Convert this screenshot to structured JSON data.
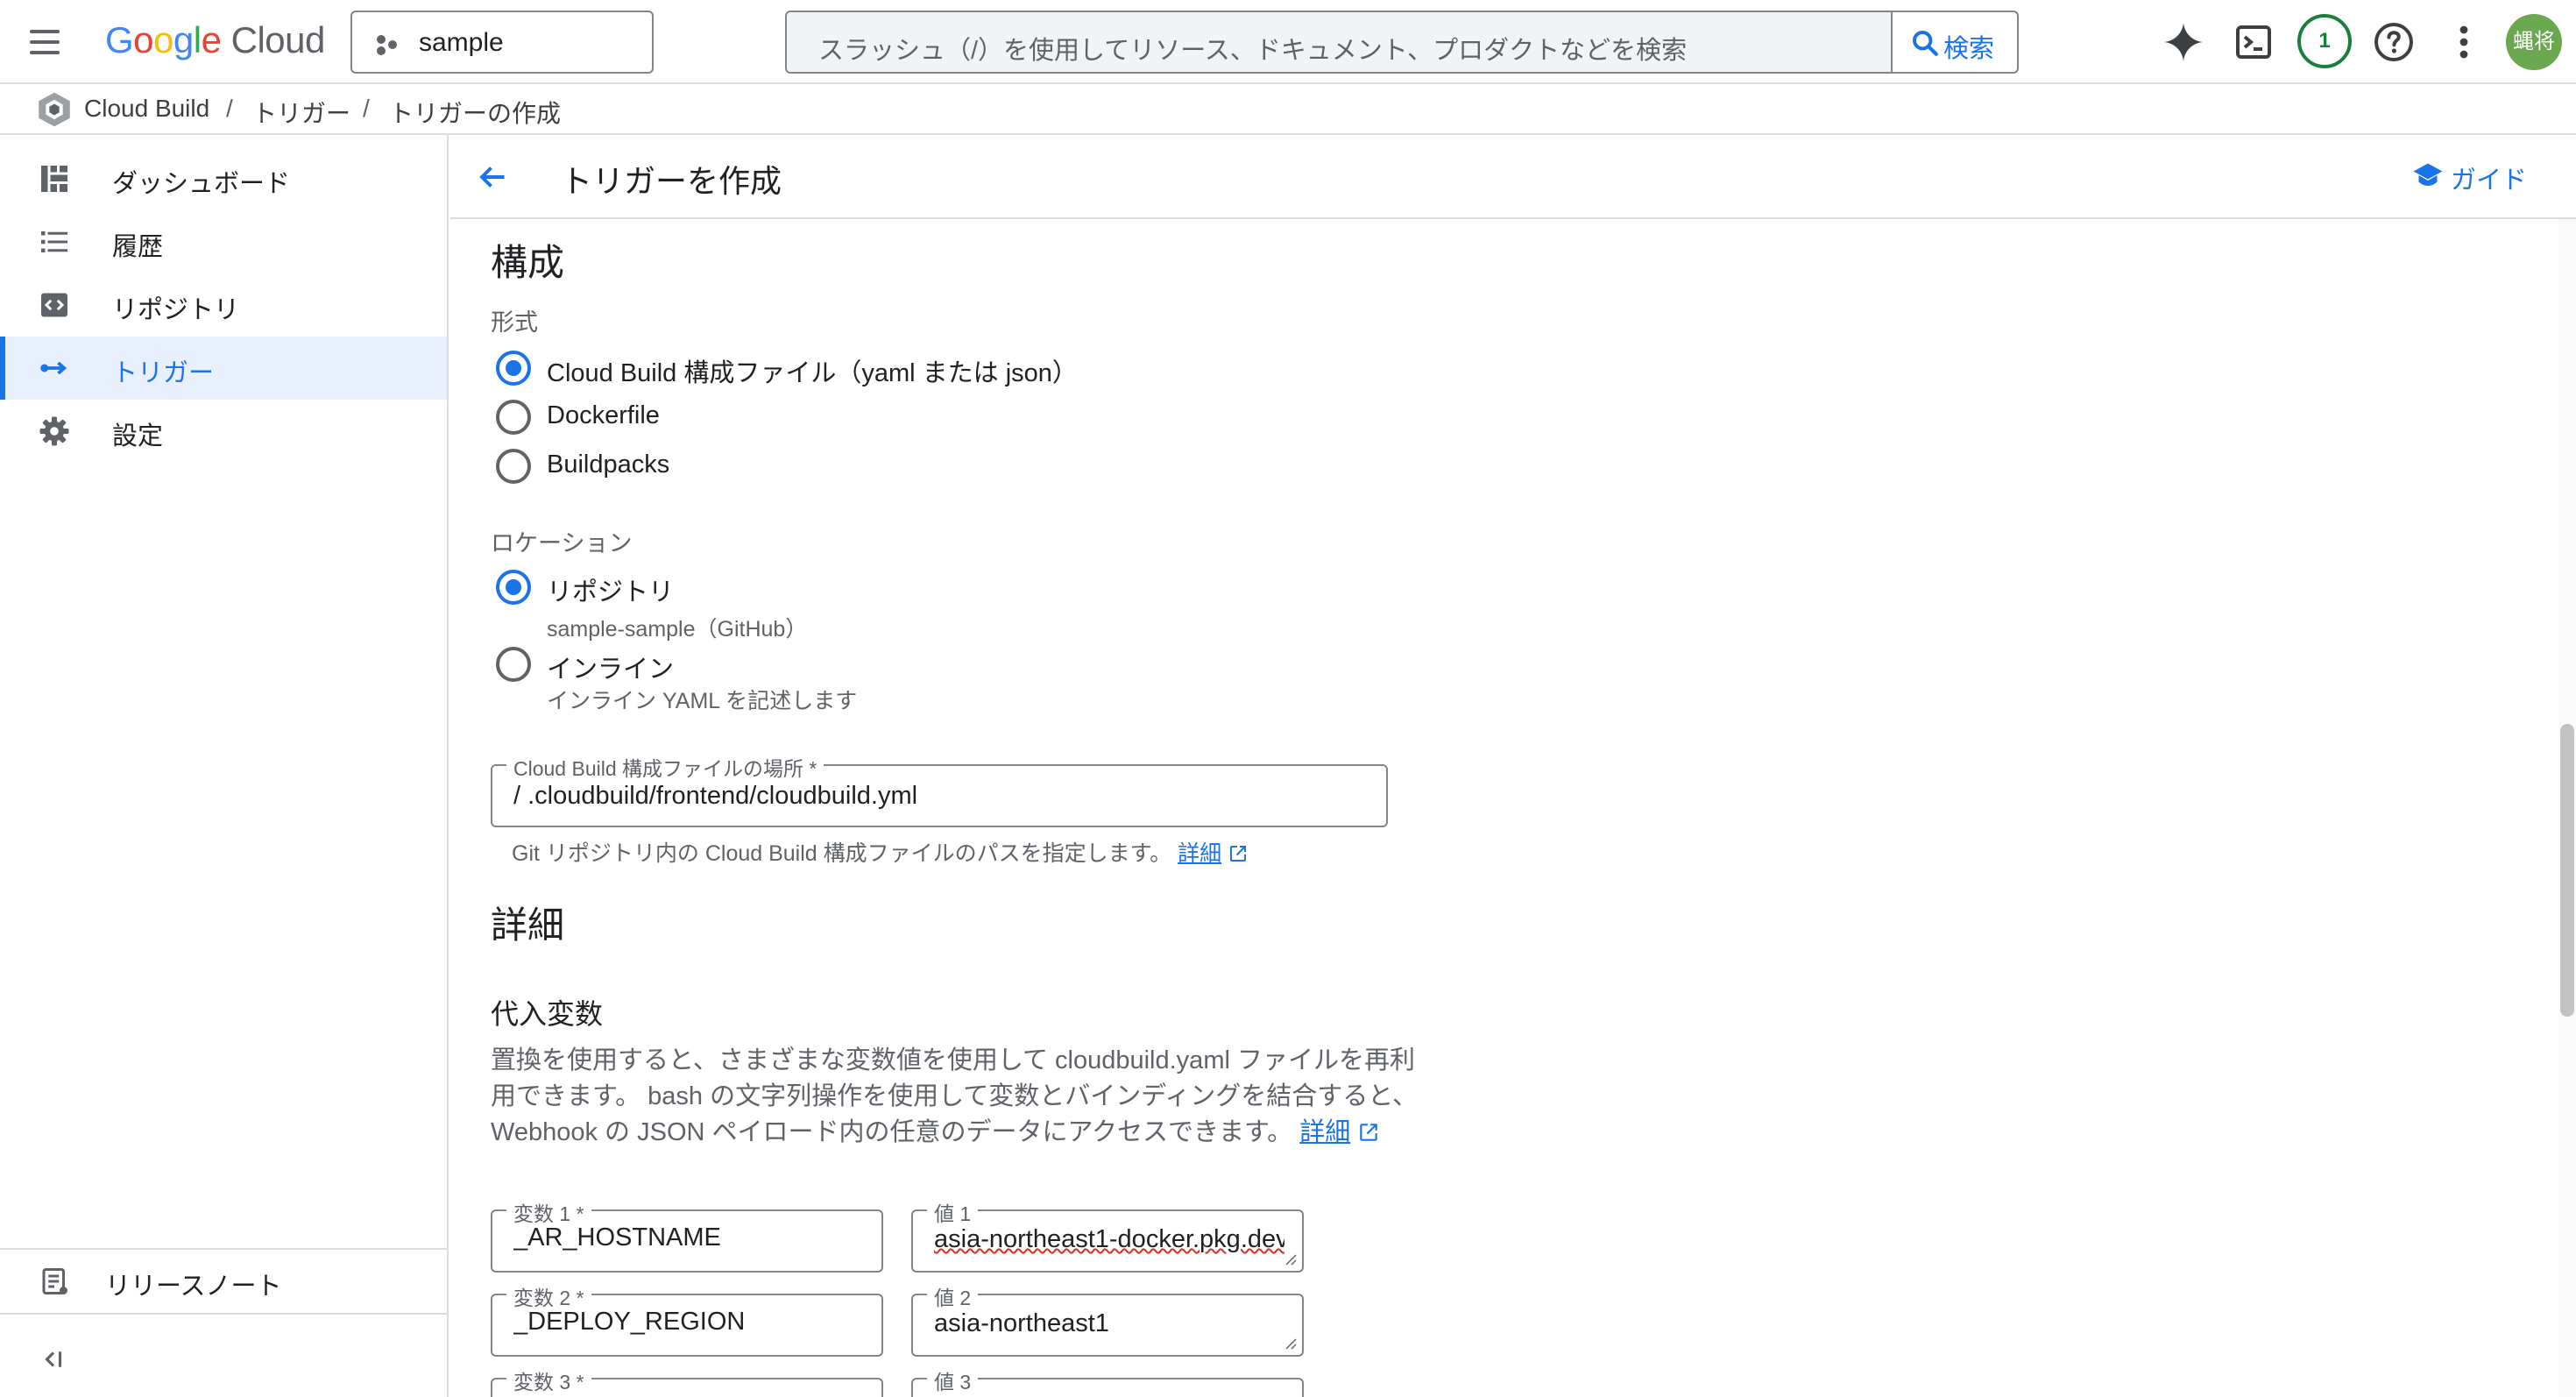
{
  "topbar": {
    "logo": {
      "g1": "G",
      "g2": "o",
      "g3": "o",
      "g4": "g",
      "g5": "l",
      "g6": "e",
      "cloud": " Cloud"
    },
    "project_name": "sample",
    "search_placeholder": "スラッシュ（/）を使用してリソース、ドキュメント、プロダクトなどを検索",
    "search_button": "検索",
    "notification_count": "1",
    "avatar_initials": "蝿将"
  },
  "breadcrumb": [
    "Cloud Build",
    "トリガー",
    "トリガーの作成"
  ],
  "breadcrumb_sep": "/",
  "sidebar": {
    "items": [
      {
        "label": "ダッシュボード",
        "icon": "dashboard-icon"
      },
      {
        "label": "履歴",
        "icon": "list-icon"
      },
      {
        "label": "リポジトリ",
        "icon": "repository-icon"
      },
      {
        "label": "トリガー",
        "icon": "trigger-arrow-icon",
        "active": true
      },
      {
        "label": "設定",
        "icon": "gear-icon"
      }
    ],
    "release_notes": "リリースノート",
    "collapse_icon": "collapse-icon"
  },
  "header": {
    "title": "トリガーを作成",
    "guide": "ガイド"
  },
  "config": {
    "section_title": "構成",
    "format_label": "形式",
    "format_options": [
      {
        "label": "Cloud Build 構成ファイル（yaml または json）",
        "selected": true
      },
      {
        "label": "Dockerfile",
        "selected": false
      },
      {
        "label": "Buildpacks",
        "selected": false
      }
    ],
    "location_label": "ロケーション",
    "location_options": [
      {
        "label": "リポジトリ",
        "sub": "sample-sample（GitHub）",
        "selected": true
      },
      {
        "label": "インライン",
        "sub": "インライン YAML を記述します",
        "selected": false
      }
    ],
    "file_field": {
      "label": "Cloud Build 構成ファイルの場所 *",
      "value": "/ .cloudbuild/frontend/cloudbuild.yml"
    },
    "file_help": "Git リポジトリ内の Cloud Build 構成ファイルのパスを指定します。",
    "file_help_link": "詳細"
  },
  "details": {
    "section_title": "詳細",
    "substitutions_title": "代入変数",
    "substitutions_desc": [
      "置換を使用すると、さまざまな変数値を使用して cloudbuild.yaml ファイルを再利",
      "用できます。 bash の文字列操作を使用して変数とバインディングを結合すると、",
      "Webhook の JSON ペイロード内の任意のデータにアクセスできます。"
    ],
    "substitutions_link": "詳細",
    "variables": [
      {
        "var_label": "変数 1 *",
        "var_value": "_AR_HOSTNAME",
        "val_label": "値 1",
        "val_value": "asia-northeast1-docker.pkg.dev"
      },
      {
        "var_label": "変数 2 *",
        "var_value": "_DEPLOY_REGION",
        "val_label": "値 2",
        "val_value": "asia-northeast1"
      },
      {
        "var_label": "変数 3 *",
        "var_value": "",
        "val_label": "値 3",
        "val_value": ""
      }
    ]
  },
  "colors": {
    "accent": "#1a73e8",
    "notif": "#188038",
    "avatar": "#6aa84f"
  }
}
